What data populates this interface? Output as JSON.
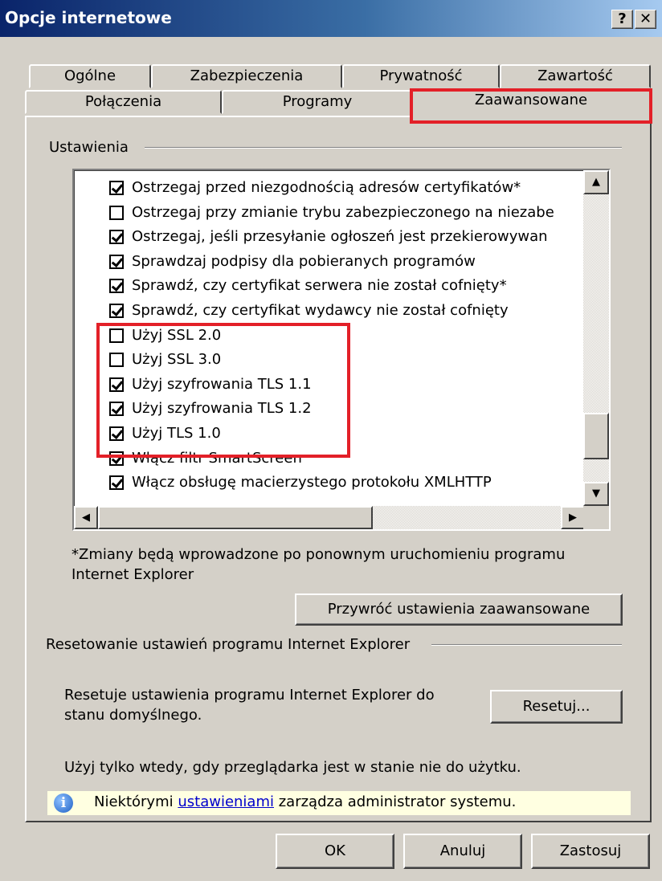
{
  "window": {
    "title": "Opcje internetowe",
    "help_button": "?",
    "close_button": "✕"
  },
  "tabs": {
    "row1": [
      "Ogólne",
      "Zabezpieczenia",
      "Prywatność",
      "Zawartość"
    ],
    "row2": [
      "Połączenia",
      "Programy",
      "Zaawansowane"
    ],
    "active": "Zaawansowane"
  },
  "settings": {
    "group_label": "Ustawienia",
    "items": [
      {
        "label": "Ostrzegaj przed niezgodnością adresów certyfikatów*",
        "checked": true
      },
      {
        "label": "Ostrzegaj przy zmianie trybu zabezpieczonego na niezabe",
        "checked": false
      },
      {
        "label": "Ostrzegaj, jeśli przesyłanie ogłoszeń jest przekierowywan",
        "checked": true
      },
      {
        "label": "Sprawdzaj podpisy dla pobieranych programów",
        "checked": true
      },
      {
        "label": "Sprawdź, czy certyfikat serwera nie został cofnięty*",
        "checked": true
      },
      {
        "label": "Sprawdź, czy certyfikat wydawcy nie został cofnięty",
        "checked": true
      },
      {
        "label": "Użyj SSL 2.0",
        "checked": false
      },
      {
        "label": "Użyj SSL 3.0",
        "checked": false
      },
      {
        "label": "Użyj szyfrowania TLS 1.1",
        "checked": true
      },
      {
        "label": "Użyj szyfrowania TLS 1.2",
        "checked": true
      },
      {
        "label": "Użyj TLS 1.0",
        "checked": true
      },
      {
        "label": "Włącz filtr SmartScreen",
        "checked": true
      },
      {
        "label": "Włącz obsługę macierzystego protokołu XMLHTTP",
        "checked": true
      }
    ],
    "note_line1": "*Zmiany będą wprowadzone po ponownym uruchomieniu programu",
    "note_line2": "Internet Explorer",
    "restore_button": "Przywróć ustawienia zaawansowane"
  },
  "reset": {
    "group_label": "Resetowanie ustawień programu Internet Explorer",
    "desc_line1": "Resetuje ustawienia programu Internet Explorer do",
    "desc_line2": "stanu domyślnego.",
    "reset_button": "Resetuj...",
    "warning": "Użyj tylko wtedy, gdy przeglądarka jest w stanie nie do użytku."
  },
  "info": {
    "prefix": "Niektórymi ",
    "link": "ustawieniami",
    "suffix": " zarządza administrator systemu."
  },
  "footer": {
    "ok": "OK",
    "cancel": "Anuluj",
    "apply": "Zastosuj"
  },
  "colors": {
    "highlight": "#e32028",
    "title_bar": "#0a246a",
    "dialog_bg": "#d4d0c8",
    "info_bg": "#ffffe1"
  }
}
